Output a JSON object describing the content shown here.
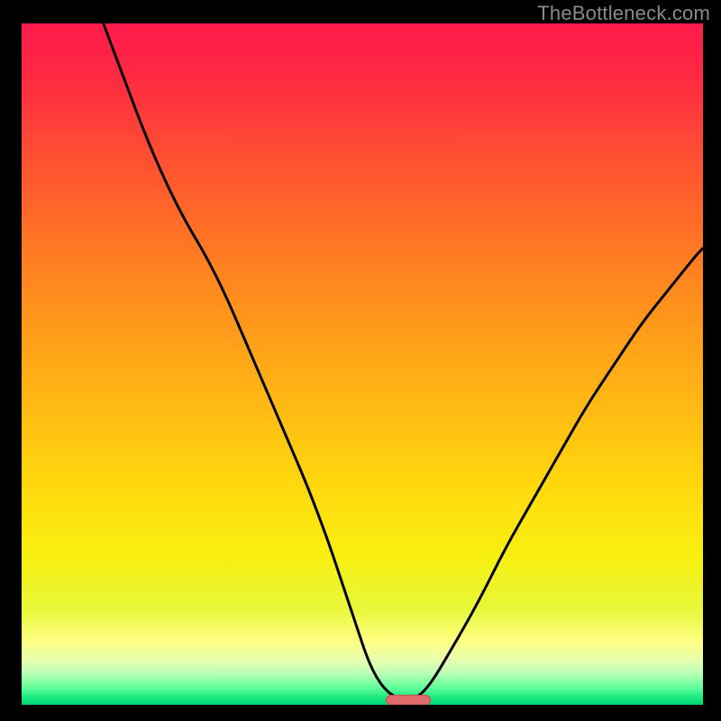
{
  "watermark": "TheBottleneck.com",
  "colors": {
    "gradient_stops": [
      {
        "offset": 0.0,
        "color": "#ff1a4b"
      },
      {
        "offset": 0.08,
        "color": "#ff2a42"
      },
      {
        "offset": 0.18,
        "color": "#ff4a34"
      },
      {
        "offset": 0.3,
        "color": "#ff6f26"
      },
      {
        "offset": 0.42,
        "color": "#ff931c"
      },
      {
        "offset": 0.55,
        "color": "#ffb614"
      },
      {
        "offset": 0.68,
        "color": "#ffd90e"
      },
      {
        "offset": 0.78,
        "color": "#f8ef10"
      },
      {
        "offset": 0.86,
        "color": "#e7f73a"
      },
      {
        "offset": 0.905,
        "color": "#ffff80"
      },
      {
        "offset": 0.935,
        "color": "#e8ffb0"
      },
      {
        "offset": 0.955,
        "color": "#b6ffb6"
      },
      {
        "offset": 0.975,
        "color": "#60ff9a"
      },
      {
        "offset": 0.99,
        "color": "#18e880"
      },
      {
        "offset": 1.0,
        "color": "#00d873"
      }
    ],
    "curve": "#000000",
    "marker_fill": "#e06a6a",
    "marker_stroke": "#c94f4f"
  },
  "chart_data": {
    "type": "line",
    "title": "",
    "xlabel": "",
    "ylabel": "",
    "xlim": [
      0,
      100
    ],
    "ylim": [
      0,
      100
    ],
    "series": [
      {
        "name": "bottleneck-curve",
        "x": [
          12,
          15,
          18,
          21,
          24,
          27,
          30,
          33,
          36,
          39,
          42,
          45,
          47,
          49,
          51,
          53,
          55,
          56.5,
          58,
          60,
          63,
          67,
          71,
          75,
          79,
          83,
          87,
          91,
          95,
          99,
          100
        ],
        "values": [
          100,
          92,
          84,
          77,
          71,
          66,
          60,
          53,
          46,
          39,
          32,
          24,
          18,
          12,
          6,
          2.5,
          1,
          0.6,
          1,
          3,
          8,
          15,
          23,
          30,
          37,
          44,
          50,
          56,
          61,
          66,
          67
        ]
      }
    ],
    "marker": {
      "name": "optimal-range-marker",
      "x_start": 53.5,
      "x_end": 60,
      "y": 0.7,
      "height": 1.4
    }
  }
}
